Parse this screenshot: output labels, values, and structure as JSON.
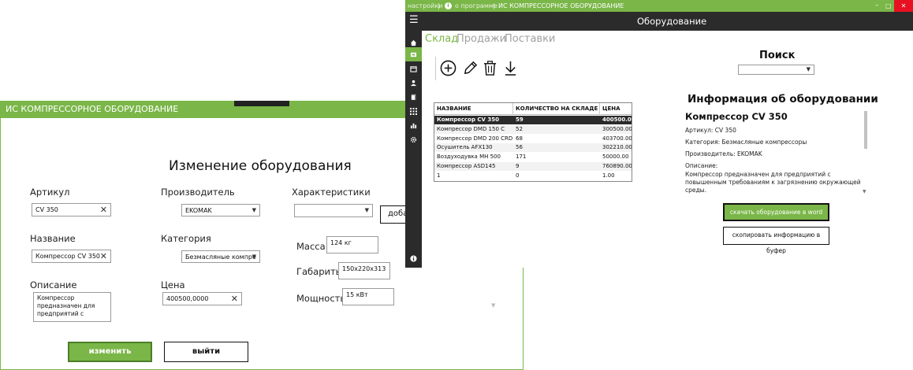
{
  "edit_window": {
    "title": "ИС КОМПРЕССОРНОЕ ОБОРУДОВАНИЕ",
    "heading": "Изменение оборудования",
    "article_label": "Артикул",
    "article_value": "CV 350",
    "name_label": "Название",
    "name_value": "Компрессор CV 350",
    "description_label": "Описание",
    "description_value": "Компрессор предназначен для предприятий с",
    "manufacturer_label": "Производитель",
    "manufacturer_value": "EKOMAK",
    "category_label": "Категория",
    "category_value": "Безмасляные компре",
    "price_label": "Цена",
    "price_value": "400500,0000",
    "characteristics_label": "Характеристики",
    "characteristics_value": "",
    "add_button": "доба",
    "mass_label": "Масса:",
    "mass_value": "124 кг",
    "dimensions_label": "Габариты:",
    "dimensions_value": "150x220x313",
    "power_label": "Мощность:",
    "power_value": "15 кВт",
    "change_button": "изменить",
    "exit_button": "выйти"
  },
  "main_window": {
    "menu_settings": "настройки",
    "menu_about": "о программе",
    "title": "ИС КОМПРЕССОРНОЕ ОБОРУДОВАНИЕ",
    "appbar_title": "Оборудование",
    "tabs": [
      "Склад",
      "Продажи",
      "Поставки"
    ],
    "search_title": "Поиск",
    "table": {
      "headers": [
        "НАЗВАНИЕ",
        "КОЛИЧЕСТВО НА СКЛАДЕ",
        "ЦЕНА"
      ],
      "rows": [
        [
          "Компрессор CV 350",
          "59",
          "400500.00"
        ],
        [
          "Компрессор DMD 150 C",
          "52",
          "300500.00"
        ],
        [
          "Компрессор DMD 200 CRD",
          "68",
          "403700.00"
        ],
        [
          "Осушитель AFX130",
          "56",
          "302210.00"
        ],
        [
          "Воздуходувка MH 500",
          "171",
          "50000.00"
        ],
        [
          "Компрессор ASD145",
          "9",
          "760890.00"
        ],
        [
          "1",
          "0",
          "1.00"
        ]
      ]
    },
    "info": {
      "heading": "Информация об оборудовании",
      "product_name": "Компрессор CV 350",
      "article": "Артикул: CV 350",
      "category": "Категория: Безмасляные компрессоры",
      "manufacturer": "Производитель: EKOMAK",
      "description_label": "Описание:",
      "description": "Компрессор предназначен для предприятий с повышенным требованиям к загрязнению окружающей среды."
    },
    "download_word_button": "скачать оборудование в word",
    "copy_buffer_button": "скопировать информацию в буфер"
  },
  "colors": {
    "accent": "#7ab648",
    "dark": "#2b2b2b",
    "selected_row": "#2b2b2b"
  }
}
